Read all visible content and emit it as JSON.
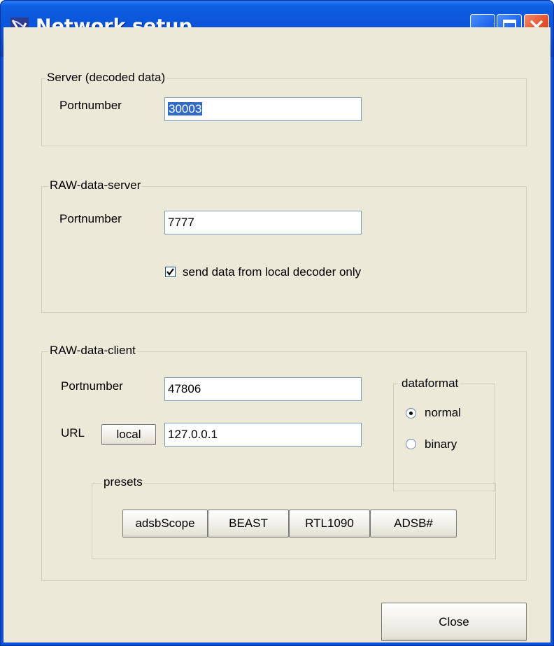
{
  "window": {
    "title": "Network setup",
    "controls": {
      "minimize": "minimize-icon",
      "maximize": "maximize-icon",
      "close": "close-icon"
    }
  },
  "server": {
    "legend": "Server (decoded data)",
    "port_label": "Portnumber",
    "port_value": "30003"
  },
  "raw_server": {
    "legend": "RAW-data-server",
    "port_label": "Portnumber",
    "port_value": "7777",
    "checkbox_label": "send data from local decoder only",
    "checkbox_checked": true
  },
  "raw_client": {
    "legend": "RAW-data-client",
    "port_label": "Portnumber",
    "port_value": "47806",
    "url_label": "URL",
    "local_button": "local",
    "url_value": "127.0.0.1",
    "dataformat": {
      "legend": "dataformat",
      "options": [
        "normal",
        "binary"
      ],
      "selected": "normal"
    },
    "presets": {
      "legend": "presets",
      "buttons": [
        "adsbScope",
        "BEAST",
        "RTL1090",
        "ADSB#"
      ]
    }
  },
  "footer": {
    "close_button": "Close"
  },
  "colors": {
    "titlebar": "#0a53d9",
    "dialog_bg": "#ece9d8",
    "selection": "#316ac5"
  }
}
